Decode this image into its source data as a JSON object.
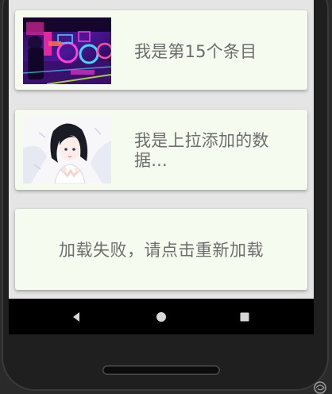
{
  "list": {
    "items": [
      {
        "text": "我是第15个条目",
        "thumbnail": "neon-city-illustration"
      },
      {
        "text": "我是上拉添加的数据...",
        "thumbnail": "anime-girl-illustration"
      }
    ],
    "load_more": {
      "error_text": "加载失败，请点击重新加载"
    }
  },
  "navigation": {
    "back_icon": "back-triangle-icon",
    "home_icon": "home-circle-icon",
    "recent_icon": "recent-square-icon"
  },
  "colors": {
    "card_background": "#f6fbf0",
    "screen_background": "#e5e5e5",
    "text": "#6d6d6d",
    "nav_bar": "#000000",
    "device_frame": "#1f1f1f"
  }
}
